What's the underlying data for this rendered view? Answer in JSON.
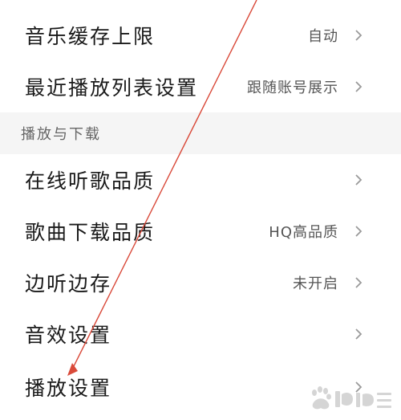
{
  "settings": {
    "items_top": [
      {
        "label": "音乐缓存上限",
        "value": "自动"
      },
      {
        "label": "最近播放列表设置",
        "value": "跟随账号展示"
      }
    ],
    "section_title": "播放与下载",
    "items_bottom": [
      {
        "label": "在线听歌品质",
        "value": ""
      },
      {
        "label": "歌曲下载品质",
        "value": "HQ高品质"
      },
      {
        "label": "边听边存",
        "value": "未开启"
      },
      {
        "label": "音效设置",
        "value": ""
      },
      {
        "label": "播放设置",
        "value": ""
      }
    ]
  },
  "annotation": {
    "color": "#d94a3a"
  },
  "watermark": {
    "icon": "baidu-jingyan-logo"
  }
}
